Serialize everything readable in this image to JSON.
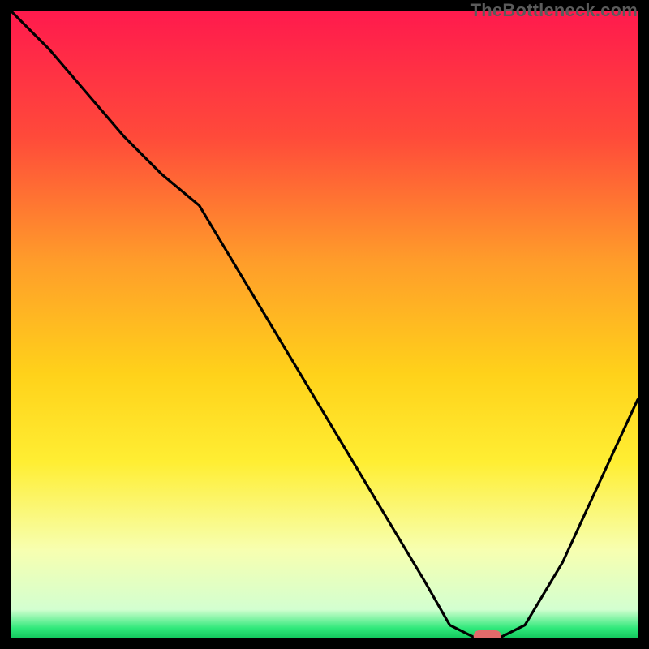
{
  "watermark": "TheBottleneck.com",
  "chart_data": {
    "type": "line",
    "title": "",
    "xlabel": "",
    "ylabel": "",
    "xlim": [
      0,
      100
    ],
    "ylim": [
      0,
      100
    ],
    "x": [
      0,
      6,
      12,
      18,
      24,
      30,
      36,
      42,
      48,
      54,
      60,
      66,
      70,
      74,
      78,
      82,
      88,
      94,
      100
    ],
    "values": [
      100,
      94,
      87,
      80,
      74,
      69,
      59,
      49,
      39,
      29,
      19,
      9,
      2,
      0,
      0,
      2,
      12,
      25,
      38
    ],
    "marker": {
      "x": 76,
      "y": 0
    },
    "gradient_stops": [
      {
        "offset": 0.0,
        "color": "#ff1a4d"
      },
      {
        "offset": 0.2,
        "color": "#ff4a3a"
      },
      {
        "offset": 0.4,
        "color": "#ff9d2a"
      },
      {
        "offset": 0.58,
        "color": "#ffd21a"
      },
      {
        "offset": 0.72,
        "color": "#ffee33"
      },
      {
        "offset": 0.86,
        "color": "#f7ffb0"
      },
      {
        "offset": 0.955,
        "color": "#d3ffd0"
      },
      {
        "offset": 0.985,
        "color": "#2fe87a"
      },
      {
        "offset": 1.0,
        "color": "#15c95f"
      }
    ]
  }
}
